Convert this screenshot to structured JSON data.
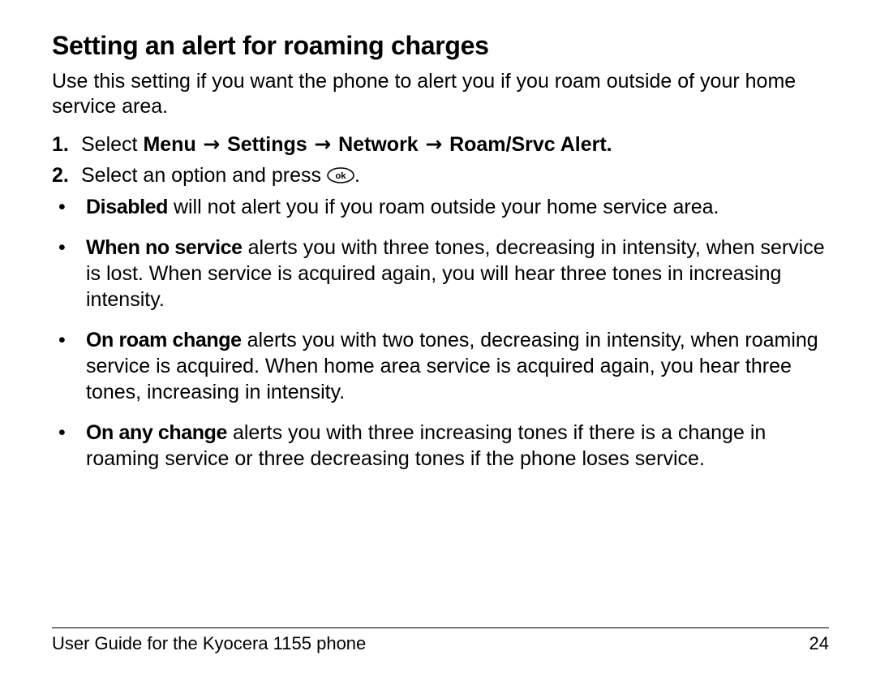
{
  "heading": "Setting an alert for roaming charges",
  "intro": "Use this setting if you want the phone to alert you if you roam outside of your home service area.",
  "steps": {
    "s1_num": "1.",
    "s1_pre": "Select ",
    "s1_path_menu": "Menu",
    "s1_path_settings": "Settings",
    "s1_path_network": "Network",
    "s1_path_last": "Roam/Srvc Alert.",
    "s2_num": "2.",
    "s2_text": "Select an option and press ",
    "s2_end": "."
  },
  "arrow": " → ",
  "options": {
    "o1_label": "Disabled",
    "o1_text": " will not alert you if you roam outside your home service area.",
    "o2_label": "When no service",
    "o2_text": " alerts you with three tones, decreasing in intensity, when service is lost. When service is acquired again, you will hear three tones in increasing intensity.",
    "o3_label": "On roam change",
    "o3_text": " alerts you with two tones, decreasing in intensity, when roaming service is acquired. When home area service is acquired again, you hear three tones, increasing in intensity.",
    "o4_label": "On any change",
    "o4_text": " alerts you with three increasing tones if there is a change in roaming service or three decreasing tones if the phone loses service."
  },
  "footer": {
    "left": "User Guide for the Kyocera 1155 phone",
    "right": "24"
  },
  "ok_icon_label": "ok"
}
